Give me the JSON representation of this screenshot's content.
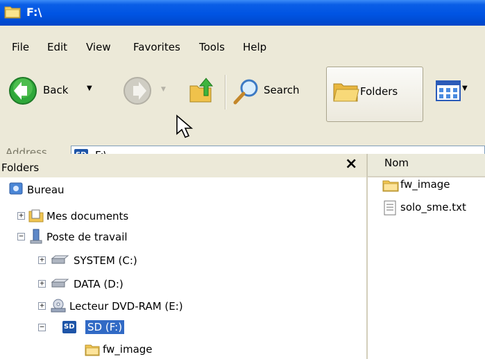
{
  "window": {
    "title": "F:\\"
  },
  "menu": [
    "File",
    "Edit",
    "View",
    "Favorites",
    "Tools",
    "Help"
  ],
  "toolbar": {
    "back_label": "Back",
    "search_label": "Search",
    "folders_label": "Folders"
  },
  "address": {
    "label": "Address",
    "value": "F:\\"
  },
  "folders_pane": {
    "title": "Folders",
    "close_glyph": "×",
    "tree": {
      "desktop": "Bureau",
      "my_documents": "Mes documents",
      "my_computer": "Poste de travail",
      "drive_c": "SYSTEM (C:)",
      "drive_d": "DATA (D:)",
      "drive_e": "Lecteur DVD-RAM (E:)",
      "drive_f": "SD (F:)",
      "fw_image": "fw_image"
    }
  },
  "file_list": {
    "column_name": "Nom",
    "items": [
      "fw_image",
      "solo_sme.txt"
    ]
  },
  "icons": {
    "sd_badge": "SD"
  }
}
